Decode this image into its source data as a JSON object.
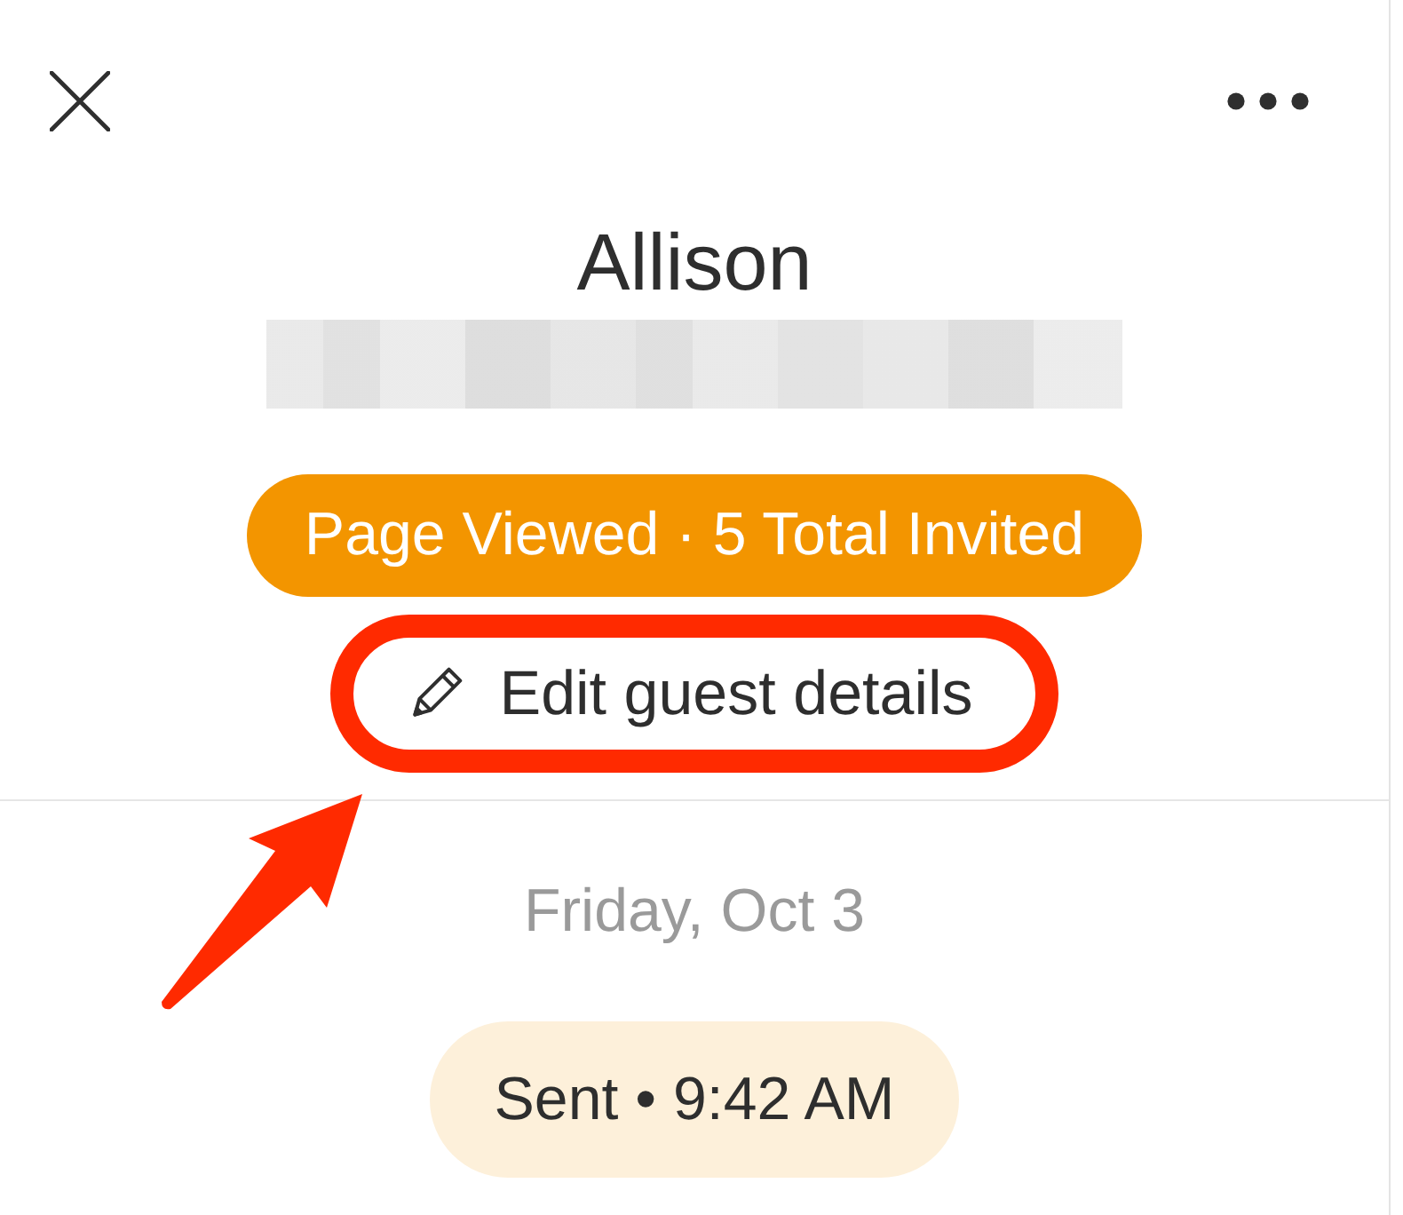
{
  "guest": {
    "name": "Allison",
    "status": "Page Viewed · 5 Total Invited"
  },
  "edit_button": {
    "label": "Edit guest details",
    "highlighted": true
  },
  "activity": [
    {
      "date": "Friday, Oct 3",
      "events": [
        {
          "label": "Sent • 9:42 AM"
        }
      ]
    }
  ]
}
